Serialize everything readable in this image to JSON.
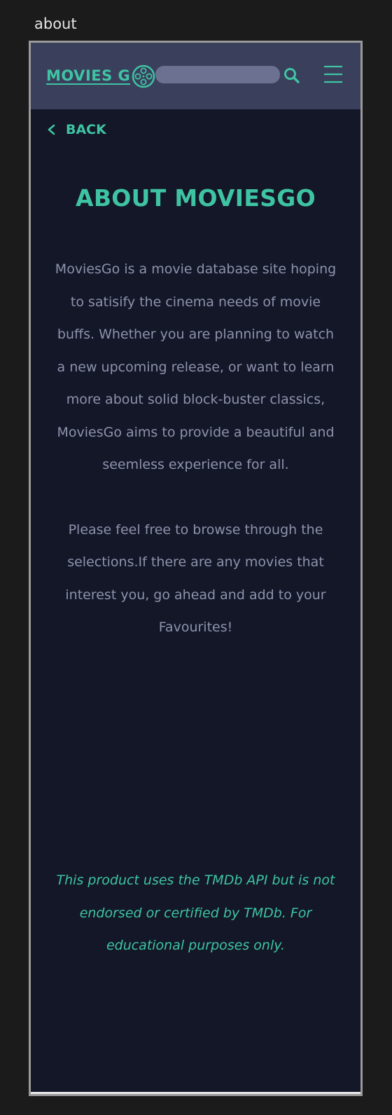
{
  "frame": {
    "label": "about"
  },
  "navbar": {
    "logo_text": "MOVIES G",
    "search_placeholder": "",
    "colors": {
      "background": "#3a3f5c",
      "accent": "#3fc4a3",
      "search_fill": "#6c7191"
    }
  },
  "back": {
    "label": "BACK"
  },
  "main": {
    "title": "ABOUT MOVIESGO",
    "paragraph_1": "MoviesGo is a movie database site hoping to satisify the cinema needs of movie buffs. Whether you are planning to watch a new upcoming release, or want to learn more about solid block-buster classics, MoviesGo aims to provide a beautiful and seemless experience for all.",
    "paragraph_2": "Please feel free to browse through the selections.If there are any movies that interest you, go ahead and add to your Favourites!"
  },
  "footer": {
    "disclaimer": "This product uses the TMDb API but is not endorsed or certified by TMDb. For educational purposes only."
  },
  "theme": {
    "page_background": "#131728",
    "body_text": "#8e93ad"
  }
}
